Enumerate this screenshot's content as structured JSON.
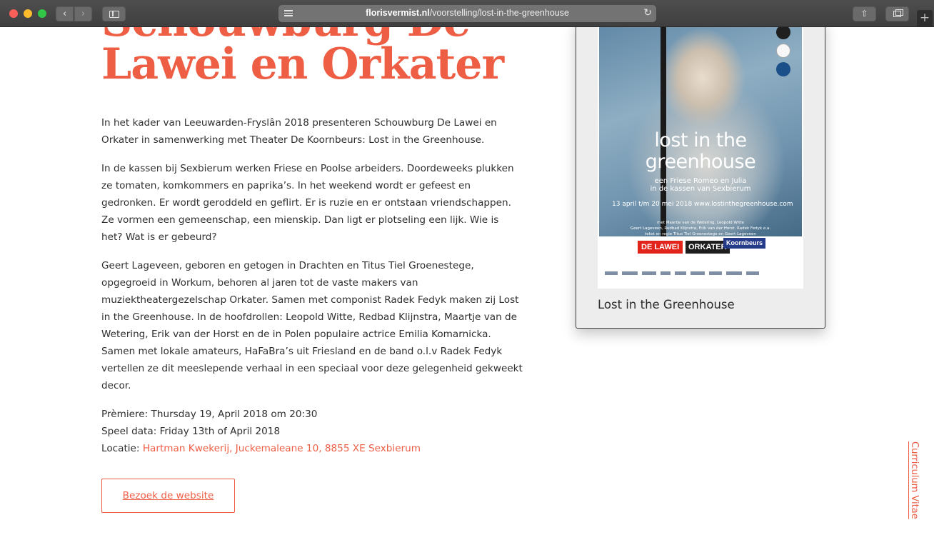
{
  "browser": {
    "url_domain": "florisvermist.nl",
    "url_path": "/voorstelling/lost-in-the-greenhouse",
    "icons": [
      "back-icon",
      "forward-icon",
      "sidebar-icon",
      "reader-icon",
      "reload-icon",
      "share-icon",
      "tabs-icon",
      "new-tab-icon"
    ]
  },
  "page": {
    "heading_line1": "Schouwburg De",
    "heading_line2": "Lawei en Orkater",
    "paragraphs": [
      "In het kader van Leeuwarden-Fryslân 2018 presenteren Schouwburg De Lawei en Orkater in samenwerking met Theater De Koornbeurs: Lost in the Greenhouse.",
      "In de kassen bij Sexbierum werken Friese en Poolse arbeiders. Doordeweeks plukken ze tomaten, komkommers en paprika’s. In het weekend wordt er gefeest en gedronken. Er wordt geroddeld en geflirt. Er is ruzie en er ontstaan vriendschappen. Ze vormen een gemeenschap, een mienskip. Dan ligt er plotseling een lijk. Wie is het? Wat is er gebeurd?",
      "Geert Lageveen, geboren en getogen in Drachten en Titus Tiel Groenestege, opgegroeid in Workum, behoren al jaren tot de vaste makers van muziektheatergezelschap Orkater. Samen met componist Radek Fedyk maken zij Lost in the Greenhouse. In de hoofdrollen: Leopold Witte, Redbad Klijnstra, Maartje van de Wetering, Erik van der Horst en de in Polen populaire actrice Emilia Komarnicka. Samen met lokale amateurs, HaFaBra’s uit Friesland en de band o.l.v Radek Fedyk vertellen ze dit meeslepende verhaal in een speciaal voor deze gelegenheid gekweekt decor."
    ],
    "premiere": "Prèmiere: Thursday 19, April 2018 om 20:30",
    "play_dates": "Speel data: Friday 13th of April 2018",
    "location_label": "Locatie: ",
    "location_link": "Hartman Kwekerij, Juckemaleane 10, 8855 XE Sexbierum",
    "visit_button": "Bezoek de website",
    "cv_link": "Curriculum Vitae"
  },
  "poster": {
    "title_line1": "lost in the",
    "title_line2": "greenhouse",
    "subtitle_line1": "een Friese Romeo en Julia",
    "subtitle_line2": "in de kassen van Sexbierum",
    "dates": "13 april t/m 20 mei 2018   www.lostinthegreenhouse.com",
    "credits": [
      "met Maartje van de Wetering, Leopold Witte",
      "Geert Lageveen, Redbad Klijnstra, Erik van der Horst, Radek Fedyk e.a.",
      "tekst en regie Titus Tiel Groenestege en Geert Lageveen"
    ],
    "logos": [
      "DE LAWEI",
      "ORKATER",
      "Koornbeurs"
    ],
    "caption": "Lost in the Greenhouse"
  },
  "colors": {
    "accent": "#ee5e45",
    "text": "#2f2f2f",
    "card_bg": "#ededed"
  }
}
